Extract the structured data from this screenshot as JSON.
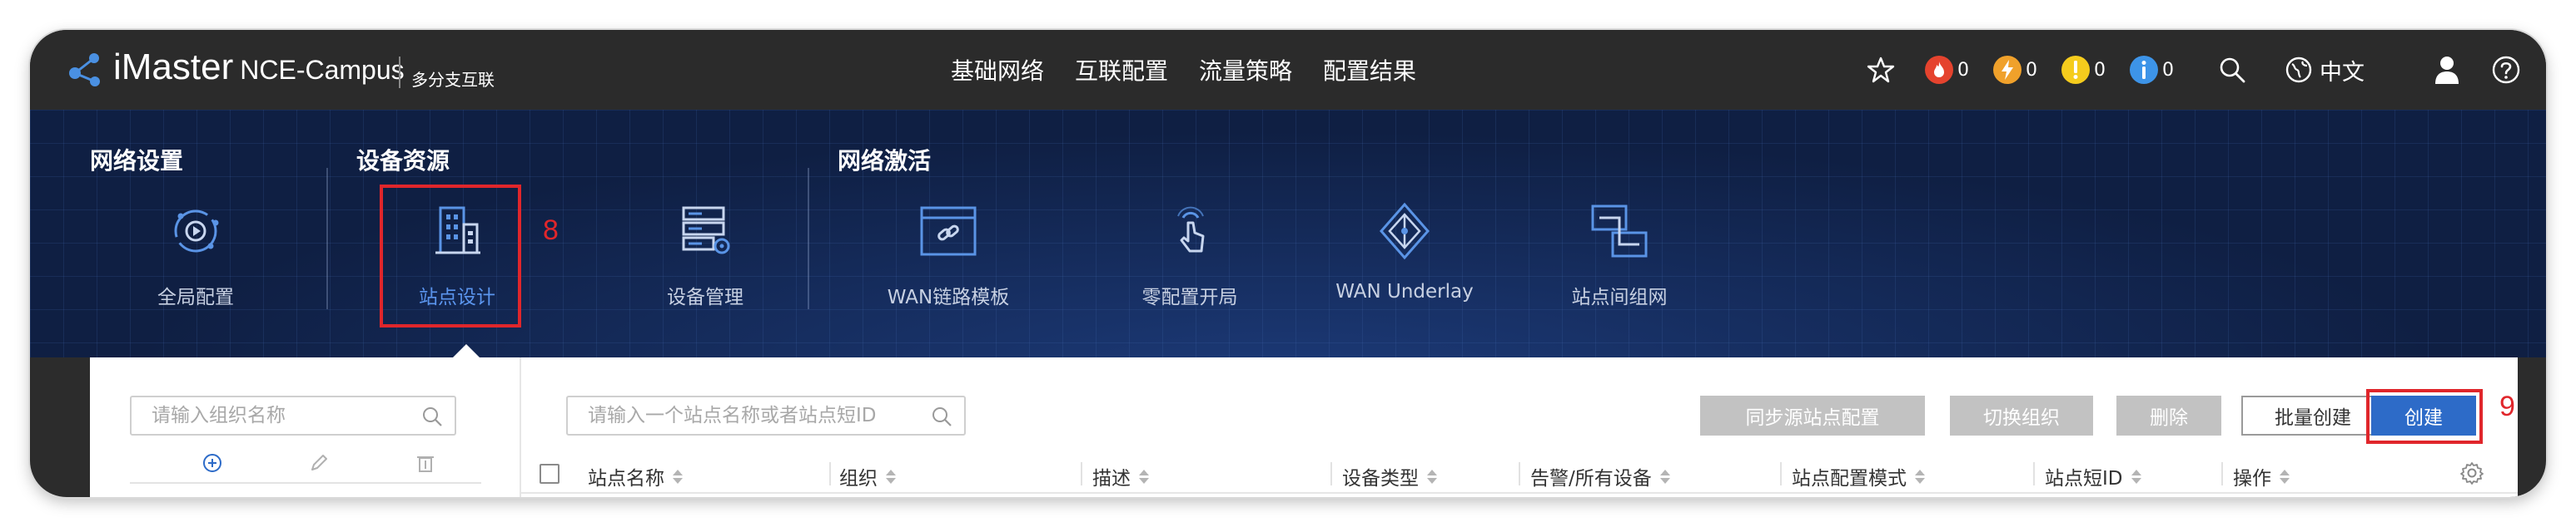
{
  "header": {
    "brand_name": "iMaster",
    "brand_product": "NCE-Campus",
    "brand_sub": "多分支互联",
    "nav": [
      "基础网络",
      "互联配置",
      "流量策略",
      "配置结果"
    ],
    "alarms": [
      {
        "name": "critical",
        "count": "0",
        "color": "#e5432e"
      },
      {
        "name": "major",
        "count": "0",
        "color": "#f0a12b"
      },
      {
        "name": "minor",
        "count": "0",
        "color": "#f5cc1d"
      },
      {
        "name": "info",
        "count": "0",
        "color": "#3d94e8"
      }
    ],
    "language": "中文"
  },
  "hero": {
    "sections": [
      "网络设置",
      "设备资源",
      "网络激活"
    ],
    "tiles": [
      {
        "label": "全局配置",
        "icon": "global-config-icon"
      },
      {
        "label": "站点设计",
        "icon": "building-icon",
        "active": true
      },
      {
        "label": "设备管理",
        "icon": "device-management-icon"
      },
      {
        "label": "WAN链路模板",
        "icon": "link-template-icon"
      },
      {
        "label": "零配置开局",
        "icon": "touch-icon"
      },
      {
        "label": "WAN Underlay",
        "icon": "underlay-icon"
      },
      {
        "label": "站点间组网",
        "icon": "site-network-icon"
      }
    ],
    "markers": [
      "8",
      "9"
    ]
  },
  "left_panel": {
    "search_placeholder": "请输入组织名称"
  },
  "main": {
    "search_placeholder": "请输入一个站点名称或者站点短ID",
    "buttons": {
      "sync": "同步源站点配置",
      "switch_org": "切换组织",
      "delete": "删除",
      "batch_create": "批量创建",
      "create": "创建"
    },
    "columns": [
      "站点名称",
      "组织",
      "描述",
      "设备类型",
      "告警/所有设备",
      "站点配置模式",
      "站点短ID",
      "操作"
    ]
  },
  "colors": {
    "accent": "#2d6bc8",
    "highlight": "#e0262b",
    "topbar": "#2b2b2b",
    "hero": "#0f1f43"
  }
}
